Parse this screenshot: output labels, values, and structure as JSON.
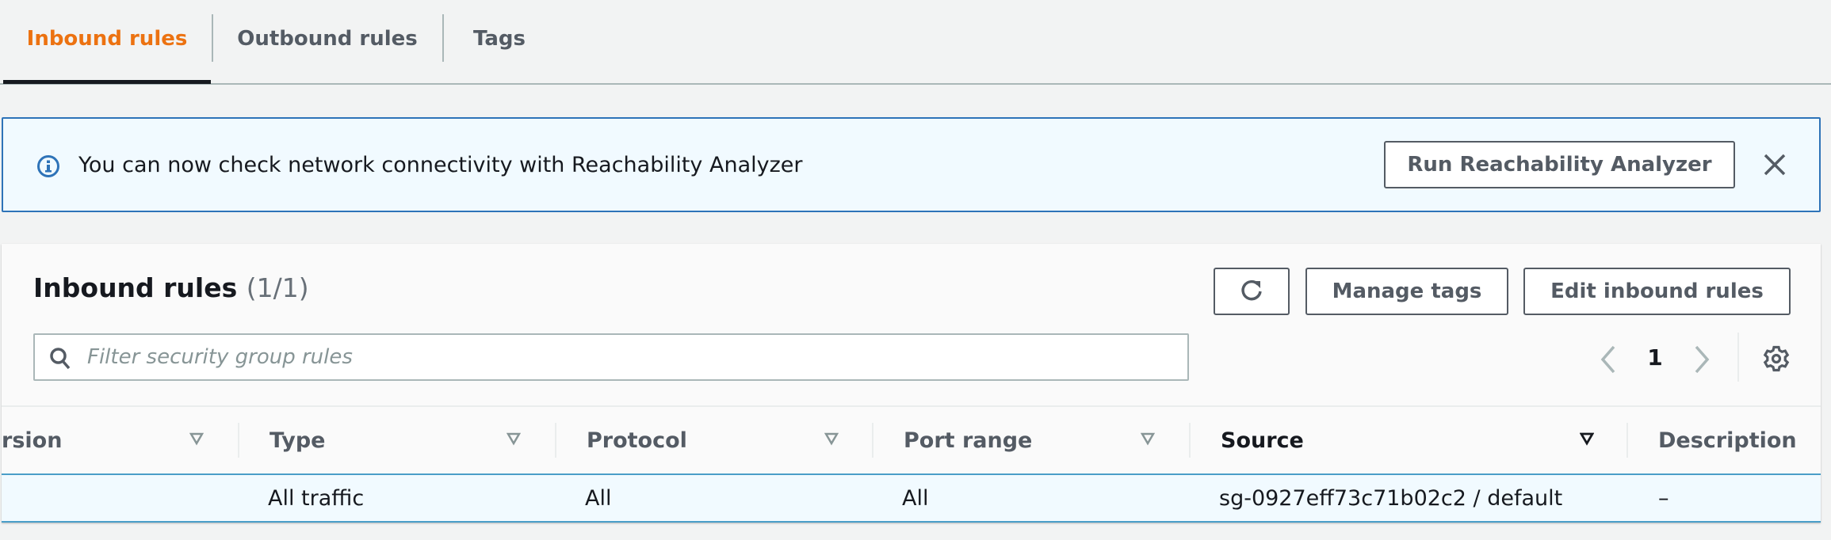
{
  "tabs": [
    {
      "label": "Inbound rules",
      "active": true
    },
    {
      "label": "Outbound rules",
      "active": false
    },
    {
      "label": "Tags",
      "active": false
    }
  ],
  "banner": {
    "icon": "info-icon",
    "message": "You can now check network connectivity with Reachability Analyzer",
    "action_label": "Run Reachability Analyzer",
    "close_icon": "close-icon"
  },
  "panel": {
    "title": "Inbound rules",
    "count": "(1/1)",
    "refresh_icon": "refresh-icon",
    "manage_tags_label": "Manage tags",
    "edit_label": "Edit inbound rules",
    "search_placeholder": "Filter security group rules",
    "search_value": "",
    "page": "1"
  },
  "table": {
    "columns": [
      {
        "label": "rsion",
        "full_label": "IP version",
        "sorted": false
      },
      {
        "label": "Type",
        "sorted": false
      },
      {
        "label": "Protocol",
        "sorted": false
      },
      {
        "label": "Port range",
        "sorted": false
      },
      {
        "label": "Source",
        "sorted": true
      },
      {
        "label": "Description",
        "sorted": false
      }
    ],
    "rows": [
      {
        "ip_version": "",
        "type": "All traffic",
        "protocol": "All",
        "port_range": "All",
        "source": "sg-0927eff73c71b02c2 / default",
        "description": "–"
      }
    ]
  },
  "colors": {
    "accent": "#ec7211",
    "info_blue": "#2e73b8",
    "selected_row": "#f1faff"
  }
}
